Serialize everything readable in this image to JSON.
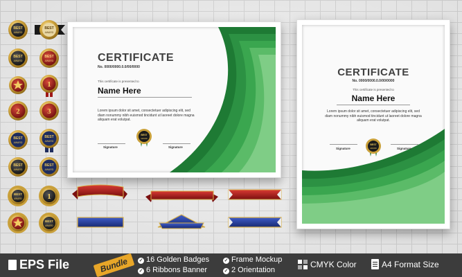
{
  "landscape_certificate": {
    "title": "CERTIFICATE",
    "number": "No. 0000/0000.0.0/00/0000",
    "presented": "This certificate is presented to",
    "name": "Name Here",
    "body": [
      "Lorem ipsum dolor sit amet, consectetuer adipiscing elit, sed",
      "diam nonummy nibh euismod tincidunt ut laoreet dolore magna",
      "aliquam erat volutpat."
    ],
    "signature_left": "Signature",
    "signature_right": "Signature"
  },
  "portrait_certificate": {
    "title": "CERTIFICATE",
    "number": "No. 0000/0000.0.0/00/0000",
    "presented": "This certificate is presented to",
    "name": "Name Here",
    "body": [
      "Lorem ipsum dolor sit amet, consectetuer adipiscing elit, sed",
      "diam nonummy nibh euismod tincidunt ut laoreet dolore magna",
      "aliquam erat volutpat."
    ],
    "signature_left": "Signature",
    "signature_right": "Signature"
  },
  "badges": {
    "texts": [
      "BEST",
      "AWARD",
      "1",
      "2",
      "3"
    ]
  },
  "footer": {
    "eps": "EPS File",
    "bundle": "Bundle",
    "feature_1": "16 Golden Badges",
    "feature_2": "6  Ribbons Banner",
    "feature_3": "Frame Mockup",
    "feature_4": "2 Orientation",
    "feature_5": "CMYK Color",
    "feature_6": "A4 Format Size"
  },
  "colors": {
    "green_dark": "#1e7a34",
    "green_mid": "#35a04a",
    "green_light": "#7cc77f",
    "gold": "#c9a03a",
    "ribbon_red": "#b3201f",
    "ribbon_blue": "#2a3f9a",
    "footer_bg": "#3c3c3c",
    "bundle_bg": "#e8a628"
  }
}
